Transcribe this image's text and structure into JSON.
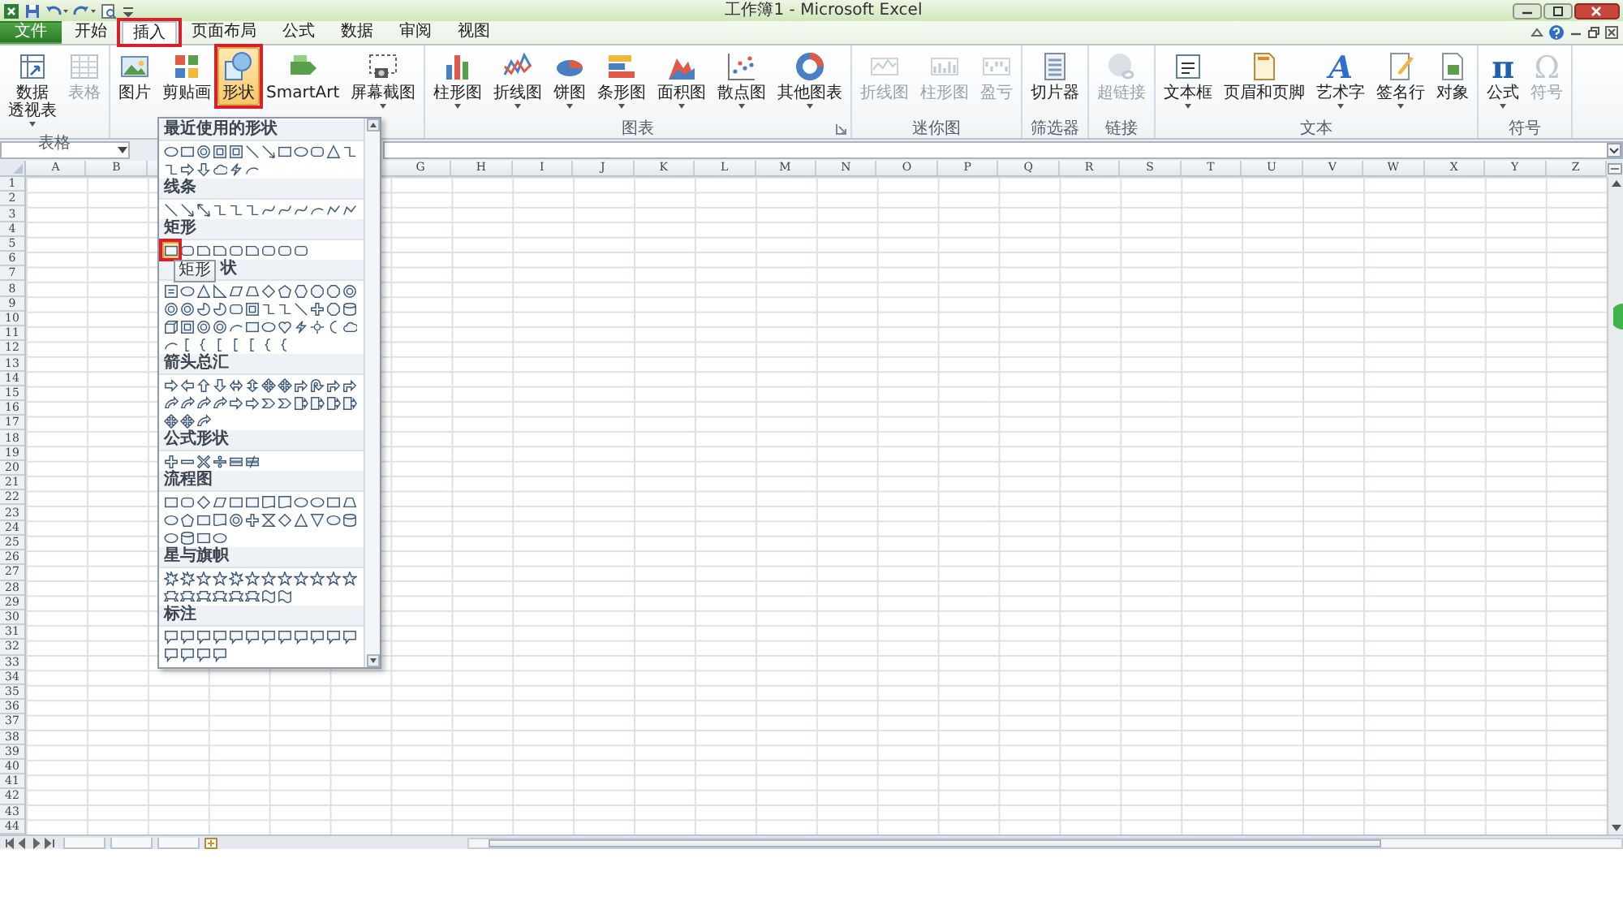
{
  "window": {
    "title": "工作簿1 - Microsoft Excel"
  },
  "tabs": [
    {
      "label": "文件",
      "kind": "file",
      "selected": false,
      "annotated": false
    },
    {
      "label": "开始",
      "kind": "tab",
      "selected": false,
      "annotated": false
    },
    {
      "label": "插入",
      "kind": "tab",
      "selected": true,
      "annotated": true
    },
    {
      "label": "页面布局",
      "kind": "tab",
      "selected": false,
      "annotated": false
    },
    {
      "label": "公式",
      "kind": "tab",
      "selected": false,
      "annotated": false
    },
    {
      "label": "数据",
      "kind": "tab",
      "selected": false,
      "annotated": false
    },
    {
      "label": "审阅",
      "kind": "tab",
      "selected": false,
      "annotated": false
    },
    {
      "label": "视图",
      "kind": "tab",
      "selected": false,
      "annotated": false
    }
  ],
  "ribbon": [
    {
      "label": "表格",
      "launcher": false,
      "buttons": [
        {
          "label": [
            "数据",
            "透视表"
          ],
          "kind": "pivot",
          "dropdown": true,
          "disabled": false,
          "selected": false,
          "annotated": false
        },
        {
          "label": [
            "表格"
          ],
          "kind": "table",
          "dropdown": false,
          "disabled": true,
          "selected": false,
          "annotated": false
        }
      ]
    },
    {
      "launcher": false,
      "buttons": [
        {
          "label": [
            "图片"
          ],
          "kind": "picture",
          "dropdown": false,
          "disabled": false,
          "selected": false,
          "annotated": false
        },
        {
          "label": [
            "剪贴画"
          ],
          "kind": "clipart",
          "dropdown": false,
          "disabled": false,
          "selected": false,
          "annotated": false
        },
        {
          "label": [
            "形状"
          ],
          "kind": "shapes",
          "dropdown": false,
          "disabled": false,
          "selected": true,
          "annotated": true
        },
        {
          "label": [
            "SmartArt"
          ],
          "kind": "smartart",
          "dropdown": false,
          "disabled": false,
          "selected": false,
          "annotated": false
        },
        {
          "label": [
            "屏幕截图"
          ],
          "kind": "screenshot",
          "dropdown": true,
          "disabled": false,
          "selected": false,
          "annotated": false
        }
      ]
    },
    {
      "label": "图表",
      "launcher": true,
      "buttons": [
        {
          "label": [
            "柱形图"
          ],
          "kind": "column",
          "dropdown": true,
          "disabled": false,
          "selected": false,
          "annotated": false
        },
        {
          "label": [
            "折线图"
          ],
          "kind": "line",
          "dropdown": true,
          "disabled": false,
          "selected": false,
          "annotated": false
        },
        {
          "label": [
            "饼图"
          ],
          "kind": "pie",
          "dropdown": true,
          "disabled": false,
          "selected": false,
          "annotated": false
        },
        {
          "label": [
            "条形图"
          ],
          "kind": "bar",
          "dropdown": true,
          "disabled": false,
          "selected": false,
          "annotated": false
        },
        {
          "label": [
            "面积图"
          ],
          "kind": "area",
          "dropdown": true,
          "disabled": false,
          "selected": false,
          "annotated": false
        },
        {
          "label": [
            "散点图"
          ],
          "kind": "scatter",
          "dropdown": true,
          "disabled": false,
          "selected": false,
          "annotated": false
        },
        {
          "label": [
            "其他图表"
          ],
          "kind": "other",
          "dropdown": true,
          "disabled": false,
          "selected": false,
          "annotated": false
        }
      ]
    },
    {
      "label": "迷你图",
      "launcher": false,
      "buttons": [
        {
          "label": [
            "折线图"
          ],
          "kind": "spark-line",
          "dropdown": false,
          "disabled": true,
          "selected": false,
          "annotated": false
        },
        {
          "label": [
            "柱形图"
          ],
          "kind": "spark-column",
          "dropdown": false,
          "disabled": true,
          "selected": false,
          "annotated": false
        },
        {
          "label": [
            "盈亏"
          ],
          "kind": "winloss",
          "dropdown": false,
          "disabled": true,
          "selected": false,
          "annotated": false
        }
      ]
    },
    {
      "label": "筛选器",
      "launcher": false,
      "buttons": [
        {
          "label": [
            "切片器"
          ],
          "kind": "slicer",
          "dropdown": false,
          "disabled": false,
          "selected": false,
          "annotated": false
        }
      ]
    },
    {
      "label": "链接",
      "launcher": false,
      "buttons": [
        {
          "label": [
            "超链接"
          ],
          "kind": "hyperlink",
          "dropdown": false,
          "disabled": true,
          "selected": false,
          "annotated": false
        }
      ]
    },
    {
      "label": "文本",
      "launcher": false,
      "buttons": [
        {
          "label": [
            "文本框"
          ],
          "kind": "textbox",
          "dropdown": true,
          "disabled": false,
          "selected": false,
          "annotated": false
        },
        {
          "label": [
            "页眉和页脚"
          ],
          "kind": "header",
          "dropdown": false,
          "disabled": false,
          "selected": false,
          "annotated": false
        },
        {
          "label": [
            "艺术字"
          ],
          "kind": "wordart",
          "glyph": "A",
          "dropdown": true,
          "disabled": false,
          "selected": false,
          "annotated": false
        },
        {
          "label": [
            "签名行"
          ],
          "kind": "signature",
          "dropdown": true,
          "disabled": false,
          "selected": false,
          "annotated": false
        },
        {
          "label": [
            "对象"
          ],
          "kind": "object",
          "dropdown": false,
          "disabled": false,
          "selected": false,
          "annotated": false
        }
      ]
    },
    {
      "label": "符号",
      "launcher": false,
      "buttons": [
        {
          "label": [
            "公式"
          ],
          "kind": "equation",
          "glyph": "π",
          "dropdown": true,
          "disabled": false,
          "selected": false,
          "annotated": false
        },
        {
          "label": [
            "符号"
          ],
          "kind": "symbol",
          "glyph": "Ω",
          "dropdown": false,
          "disabled": true,
          "selected": false,
          "annotated": false
        }
      ]
    }
  ],
  "sheet": {
    "columns_left": [
      "A",
      "B"
    ],
    "columns_right": [
      "G",
      "H",
      "I",
      "J",
      "K",
      "L",
      "M",
      "N",
      "O",
      "P",
      "Q",
      "R",
      "S",
      "T",
      "U",
      "V",
      "W",
      "X",
      "Y",
      "Z"
    ],
    "rows": [
      "1",
      "2",
      "3",
      "4",
      "5",
      "6",
      "7",
      "8",
      "9",
      "10",
      "11",
      "12",
      "13",
      "14",
      "15",
      "16",
      "17",
      "18",
      "19",
      "20",
      "21",
      "22",
      "23",
      "24",
      "25",
      "26",
      "27",
      "28",
      "29",
      "30",
      "31",
      "32",
      "33",
      "34",
      "35",
      "36",
      "37",
      "38",
      "39",
      "40",
      "41",
      "42",
      "43",
      "44"
    ]
  },
  "shapes_menu": {
    "tooltip": "矩形",
    "sections": [
      {
        "title": "最近使用的形状",
        "shapes": [
          {
            "kind": "oval",
            "selected": false
          },
          {
            "kind": "rectangle",
            "selected": false
          },
          {
            "kind": "donut",
            "selected": false
          },
          {
            "kind": "frame",
            "selected": false
          },
          {
            "kind": "frame",
            "selected": false
          },
          {
            "kind": "line",
            "selected": false
          },
          {
            "kind": "arrow-line",
            "selected": false
          },
          {
            "kind": "rectangle",
            "selected": false
          },
          {
            "kind": "oval",
            "selected": false
          },
          {
            "kind": "rounded-rectangle",
            "selected": false
          },
          {
            "kind": "triangle",
            "selected": false
          },
          {
            "kind": "elbow",
            "selected": false
          },
          {
            "kind": "elbow",
            "selected": false
          },
          {
            "kind": "right-arrow",
            "selected": false
          },
          {
            "kind": "down-arrow",
            "selected": false
          },
          {
            "kind": "cloud",
            "selected": false
          },
          {
            "kind": "lightning",
            "selected": false
          },
          {
            "kind": "arc",
            "selected": false
          }
        ]
      },
      {
        "title": "线条",
        "shapes": [
          {
            "kind": "line",
            "selected": false
          },
          {
            "kind": "arrow-line",
            "selected": false
          },
          {
            "kind": "double-arrow-line",
            "selected": false
          },
          {
            "kind": "elbow",
            "selected": false
          },
          {
            "kind": "elbow",
            "selected": false
          },
          {
            "kind": "elbow",
            "selected": false
          },
          {
            "kind": "curve",
            "selected": false
          },
          {
            "kind": "curve",
            "selected": false
          },
          {
            "kind": "curve",
            "selected": false
          },
          {
            "kind": "arc",
            "selected": false
          },
          {
            "kind": "freeform",
            "selected": false
          },
          {
            "kind": "freeform",
            "selected": false
          }
        ]
      },
      {
        "title": "矩形",
        "shapes": [
          {
            "kind": "rectangle",
            "selected": true
          },
          {
            "kind": "rounded-rectangle",
            "selected": false
          },
          {
            "kind": "snip-rectangle",
            "selected": false
          },
          {
            "kind": "snip-rectangle",
            "selected": false
          },
          {
            "kind": "rounded-rectangle",
            "selected": false
          },
          {
            "kind": "snip-rectangle",
            "selected": false
          },
          {
            "kind": "rounded-rectangle",
            "selected": false
          },
          {
            "kind": "rounded-rectangle",
            "selected": false
          },
          {
            "kind": "rounded-rectangle",
            "selected": false
          }
        ]
      },
      {
        "title": "状",
        "shapes": [
          {
            "kind": "text-box",
            "selected": false
          },
          {
            "kind": "oval",
            "selected": false
          },
          {
            "kind": "triangle",
            "selected": false
          },
          {
            "kind": "right-triangle",
            "selected": false
          },
          {
            "kind": "parallelogram",
            "selected": false
          },
          {
            "kind": "trapezoid",
            "selected": false
          },
          {
            "kind": "diamond",
            "selected": false
          },
          {
            "kind": "pentagon",
            "selected": false
          },
          {
            "kind": "hexagon",
            "selected": false
          },
          {
            "kind": "octagon",
            "selected": false
          },
          {
            "kind": "octagon",
            "selected": false
          },
          {
            "kind": "donut",
            "selected": false
          },
          {
            "kind": "donut",
            "selected": false
          },
          {
            "kind": "donut",
            "selected": false
          },
          {
            "kind": "pie",
            "selected": false
          },
          {
            "kind": "pie",
            "selected": false
          },
          {
            "kind": "rounded-rectangle",
            "selected": false
          },
          {
            "kind": "frame",
            "selected": false
          },
          {
            "kind": "elbow",
            "selected": false
          },
          {
            "kind": "elbow",
            "selected": false
          },
          {
            "kind": "line",
            "selected": false
          },
          {
            "kind": "plus",
            "selected": false
          },
          {
            "kind": "octagon",
            "selected": false
          },
          {
            "kind": "cylinder",
            "selected": false
          },
          {
            "kind": "cube",
            "selected": false
          },
          {
            "kind": "frame",
            "selected": false
          },
          {
            "kind": "donut",
            "selected": false
          },
          {
            "kind": "donut",
            "selected": false
          },
          {
            "kind": "arc",
            "selected": false
          },
          {
            "kind": "rectangle",
            "selected": false
          },
          {
            "kind": "oval",
            "selected": false
          },
          {
            "kind": "heart",
            "selected": false
          },
          {
            "kind": "lightning",
            "selected": false
          },
          {
            "kind": "sun",
            "selected": false
          },
          {
            "kind": "moon",
            "selected": false
          },
          {
            "kind": "cloud",
            "selected": false
          },
          {
            "kind": "arc",
            "selected": false
          },
          {
            "kind": "bracket",
            "selected": false
          },
          {
            "kind": "brace",
            "selected": false
          },
          {
            "kind": "bracket",
            "selected": false
          },
          {
            "kind": "bracket",
            "selected": false
          },
          {
            "kind": "bracket",
            "selected": false
          },
          {
            "kind": "brace",
            "selected": false
          },
          {
            "kind": "brace",
            "selected": false
          }
        ]
      },
      {
        "title": "箭头总汇",
        "shapes": [
          {
            "kind": "right-arrow",
            "selected": false
          },
          {
            "kind": "left-arrow",
            "selected": false
          },
          {
            "kind": "up-arrow",
            "selected": false
          },
          {
            "kind": "down-arrow",
            "selected": false
          },
          {
            "kind": "left-right-arrow",
            "selected": false
          },
          {
            "kind": "up-down-arrow",
            "selected": false
          },
          {
            "kind": "quad-arrow",
            "selected": false
          },
          {
            "kind": "quad-arrow",
            "selected": false
          },
          {
            "kind": "bent-arrow",
            "selected": false
          },
          {
            "kind": "u-turn-arrow",
            "selected": false
          },
          {
            "kind": "bent-arrow",
            "selected": false
          },
          {
            "kind": "bent-arrow",
            "selected": false
          },
          {
            "kind": "curved-arrow",
            "selected": false
          },
          {
            "kind": "curved-arrow",
            "selected": false
          },
          {
            "kind": "curved-arrow",
            "selected": false
          },
          {
            "kind": "curved-arrow",
            "selected": false
          },
          {
            "kind": "right-arrow",
            "selected": false
          },
          {
            "kind": "right-arrow",
            "selected": false
          },
          {
            "kind": "chevron",
            "selected": false
          },
          {
            "kind": "chevron",
            "selected": false
          },
          {
            "kind": "callout-arrow",
            "selected": false
          },
          {
            "kind": "callout-arrow",
            "selected": false
          },
          {
            "kind": "callout-arrow",
            "selected": false
          },
          {
            "kind": "callout-arrow",
            "selected": false
          },
          {
            "kind": "quad-arrow",
            "selected": false
          },
          {
            "kind": "quad-arrow",
            "selected": false
          },
          {
            "kind": "curved-arrow",
            "selected": false
          }
        ]
      },
      {
        "title": "公式形状",
        "shapes": [
          {
            "kind": "plus",
            "selected": false
          },
          {
            "kind": "minus",
            "selected": false
          },
          {
            "kind": "multiply",
            "selected": false
          },
          {
            "kind": "divide",
            "selected": false
          },
          {
            "kind": "equals",
            "selected": false
          },
          {
            "kind": "not-equal",
            "selected": false
          }
        ]
      },
      {
        "title": "流程图",
        "shapes": [
          {
            "kind": "rectangle",
            "selected": false
          },
          {
            "kind": "rounded-rectangle",
            "selected": false
          },
          {
            "kind": "diamond",
            "selected": false
          },
          {
            "kind": "parallelogram",
            "selected": false
          },
          {
            "kind": "rectangle",
            "selected": false
          },
          {
            "kind": "rectangle",
            "selected": false
          },
          {
            "kind": "document",
            "selected": false
          },
          {
            "kind": "document",
            "selected": false
          },
          {
            "kind": "oval",
            "selected": false
          },
          {
            "kind": "oval",
            "selected": false
          },
          {
            "kind": "rectangle",
            "selected": false
          },
          {
            "kind": "trapezoid",
            "selected": false
          },
          {
            "kind": "oval",
            "selected": false
          },
          {
            "kind": "pentagon",
            "selected": false
          },
          {
            "kind": "rectangle",
            "selected": false
          },
          {
            "kind": "document",
            "selected": false
          },
          {
            "kind": "donut",
            "selected": false
          },
          {
            "kind": "plus",
            "selected": false
          },
          {
            "kind": "hourglass",
            "selected": false
          },
          {
            "kind": "diamond",
            "selected": false
          },
          {
            "kind": "triangle",
            "selected": false
          },
          {
            "kind": "triangle-down",
            "selected": false
          },
          {
            "kind": "oval",
            "selected": false
          },
          {
            "kind": "cylinder",
            "selected": false
          },
          {
            "kind": "oval",
            "selected": false
          },
          {
            "kind": "cylinder",
            "selected": false
          },
          {
            "kind": "rectangle",
            "selected": false
          },
          {
            "kind": "oval",
            "selected": false
          }
        ]
      },
      {
        "title": "星与旗帜",
        "shapes": [
          {
            "kind": "burst",
            "selected": false
          },
          {
            "kind": "burst",
            "selected": false
          },
          {
            "kind": "star",
            "selected": false
          },
          {
            "kind": "star",
            "selected": false
          },
          {
            "kind": "burst",
            "selected": false
          },
          {
            "kind": "star",
            "selected": false
          },
          {
            "kind": "star",
            "selected": false
          },
          {
            "kind": "star",
            "selected": false
          },
          {
            "kind": "star",
            "selected": false
          },
          {
            "kind": "star",
            "selected": false
          },
          {
            "kind": "star",
            "selected": false
          },
          {
            "kind": "star",
            "selected": false
          },
          {
            "kind": "banner",
            "selected": false
          },
          {
            "kind": "banner",
            "selected": false
          },
          {
            "kind": "banner",
            "selected": false
          },
          {
            "kind": "banner",
            "selected": false
          },
          {
            "kind": "banner",
            "selected": false
          },
          {
            "kind": "banner",
            "selected": false
          },
          {
            "kind": "wave",
            "selected": false
          },
          {
            "kind": "wave",
            "selected": false
          }
        ]
      },
      {
        "title": "标注",
        "shapes": [
          {
            "kind": "callout",
            "selected": false
          },
          {
            "kind": "callout",
            "selected": false
          },
          {
            "kind": "callout",
            "selected": false
          },
          {
            "kind": "callout",
            "selected": false
          },
          {
            "kind": "callout",
            "selected": false
          },
          {
            "kind": "callout",
            "selected": false
          },
          {
            "kind": "callout",
            "selected": false
          },
          {
            "kind": "callout",
            "selected": false
          },
          {
            "kind": "callout",
            "selected": false
          },
          {
            "kind": "callout",
            "selected": false
          },
          {
            "kind": "callout",
            "selected": false
          },
          {
            "kind": "callout",
            "selected": false
          },
          {
            "kind": "callout",
            "selected": false
          },
          {
            "kind": "callout",
            "selected": false
          },
          {
            "kind": "callout",
            "selected": false
          },
          {
            "kind": "callout",
            "selected": false
          }
        ]
      }
    ]
  }
}
